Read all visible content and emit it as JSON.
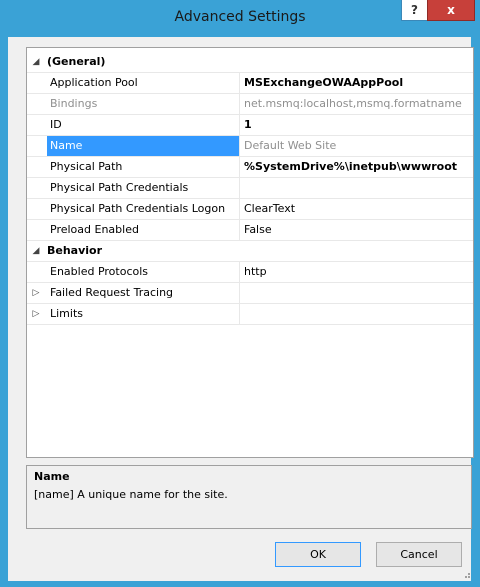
{
  "window": {
    "title": "Advanced Settings",
    "help_label": "?",
    "close_label": "x"
  },
  "grid": {
    "categories": {
      "general": {
        "label": "(General)",
        "toggle": "◢"
      },
      "behavior": {
        "label": "Behavior",
        "toggle": "◢"
      }
    },
    "rows": [
      {
        "name": "Application Pool",
        "value": "MSExchangeOWAAppPool"
      },
      {
        "name": "Bindings",
        "value": "net.msmq:localhost,msmq.formatname"
      },
      {
        "name": "ID",
        "value": "1"
      },
      {
        "name": "Name",
        "value": "Default Web Site"
      },
      {
        "name": "Physical Path",
        "value": "%SystemDrive%\\inetpub\\wwwroot"
      },
      {
        "name": "Physical Path Credentials",
        "value": ""
      },
      {
        "name": "Physical Path Credentials Logon",
        "value": "ClearText"
      },
      {
        "name": "Preload Enabled",
        "value": "False"
      },
      {
        "name": "Enabled Protocols",
        "value": "http"
      },
      {
        "name": "Failed Request Tracing",
        "value": "",
        "toggle": "▷"
      },
      {
        "name": "Limits",
        "value": "",
        "toggle": "▷"
      }
    ]
  },
  "description": {
    "title": "Name",
    "text": "[name] A unique name for the site."
  },
  "buttons": {
    "ok": "OK",
    "cancel": "Cancel"
  },
  "colors": {
    "frame": "#3aa2d6",
    "selection": "#3399ff",
    "close": "#c7403a"
  }
}
